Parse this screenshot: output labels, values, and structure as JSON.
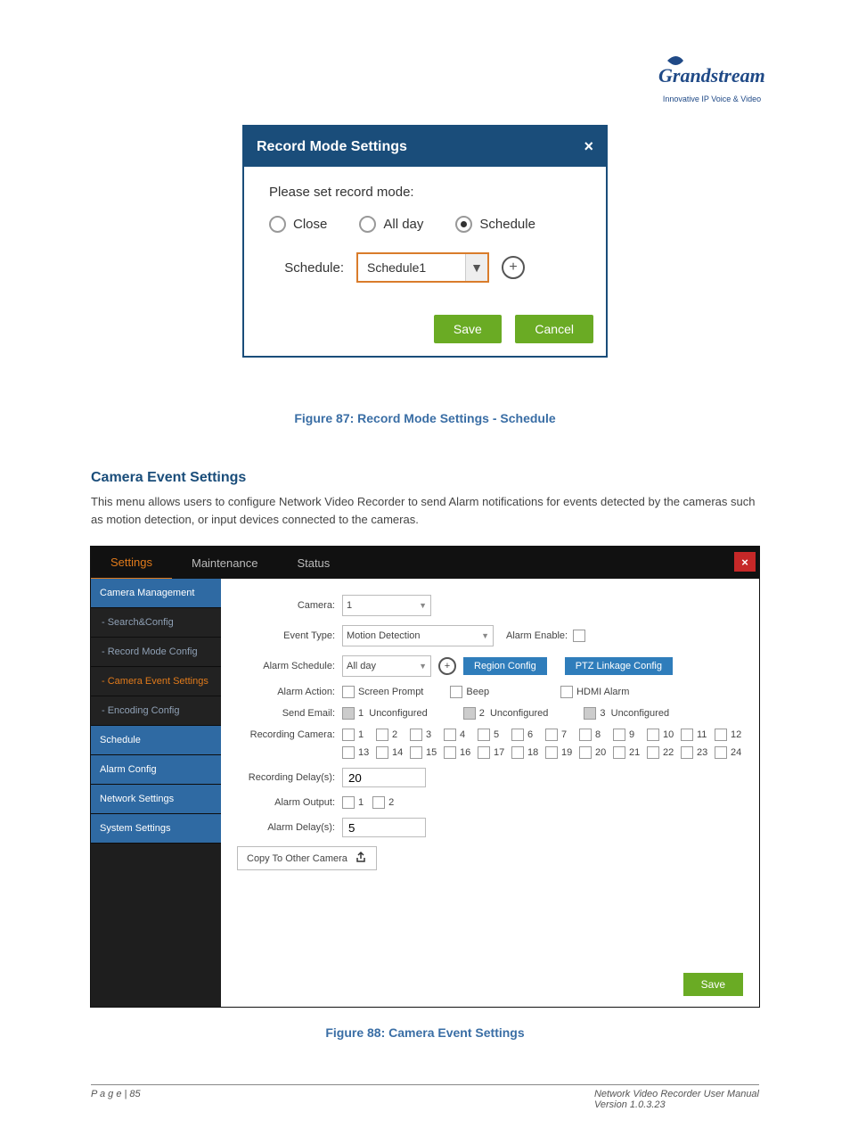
{
  "logo": {
    "brand": "Grandstream",
    "tagline": "Innovative IP Voice & Video"
  },
  "dialog": {
    "title": "Record Mode Settings",
    "prompt": "Please set record mode:",
    "options": {
      "close": "Close",
      "allday": "All day",
      "schedule": "Schedule"
    },
    "schedule_label": "Schedule:",
    "schedule_value": "Schedule1",
    "save": "Save",
    "cancel": "Cancel"
  },
  "caption1": "Figure 87: Record Mode Settings - Schedule",
  "doc_text": {
    "heading": "Camera Event Settings",
    "para": "This menu allows users to configure Network Video Recorder to send Alarm notifications for events detected by the cameras such as motion detection, or input devices connected to the cameras."
  },
  "tabs": {
    "settings": "Settings",
    "maintenance": "Maintenance",
    "status": "Status"
  },
  "sidebar": {
    "camera_mgmt": "Camera Management",
    "search": "- Search&Config",
    "record": "- Record Mode Config",
    "event": "- Camera Event Settings",
    "encoding": "- Encoding Config",
    "schedule": "Schedule",
    "alarm": "Alarm Config",
    "network": "Network Settings",
    "system": "System Settings"
  },
  "main": {
    "camera_lbl": "Camera:",
    "camera_val": "1",
    "event_lbl": "Event Type:",
    "event_val": "Motion Detection",
    "alarm_enable_lbl": "Alarm Enable:",
    "alarm_sched_lbl": "Alarm Schedule:",
    "alarm_sched_val": "All day",
    "region_btn": "Region Config",
    "ptz_btn": "PTZ Linkage Config",
    "alarm_action_lbl": "Alarm Action:",
    "act_screen": "Screen Prompt",
    "act_beep": "Beep",
    "act_hdmi": "HDMI Alarm",
    "send_email_lbl": "Send Email:",
    "email_unconf": "Unconfigured",
    "rec_cam_lbl": "Recording Camera:",
    "cams_row1": [
      "1",
      "2",
      "3",
      "4",
      "5",
      "6",
      "7",
      "8",
      "9",
      "10",
      "11",
      "12"
    ],
    "cams_row2": [
      "13",
      "14",
      "15",
      "16",
      "17",
      "18",
      "19",
      "20",
      "21",
      "22",
      "23",
      "24"
    ],
    "rec_delay_lbl": "Recording Delay(s):",
    "rec_delay_val": "20",
    "alarm_out_lbl": "Alarm Output:",
    "out1": "1",
    "out2": "2",
    "alarm_delay_lbl": "Alarm Delay(s):",
    "alarm_delay_val": "5",
    "copy_lbl": "Copy To Other Camera",
    "save": "Save"
  },
  "caption2": "Figure 88: Camera Event Settings",
  "footer": {
    "page": "P a g e",
    "num": "| 85",
    "title": "Network Video Recorder User Manual",
    "ver": "Version 1.0.3.23"
  }
}
